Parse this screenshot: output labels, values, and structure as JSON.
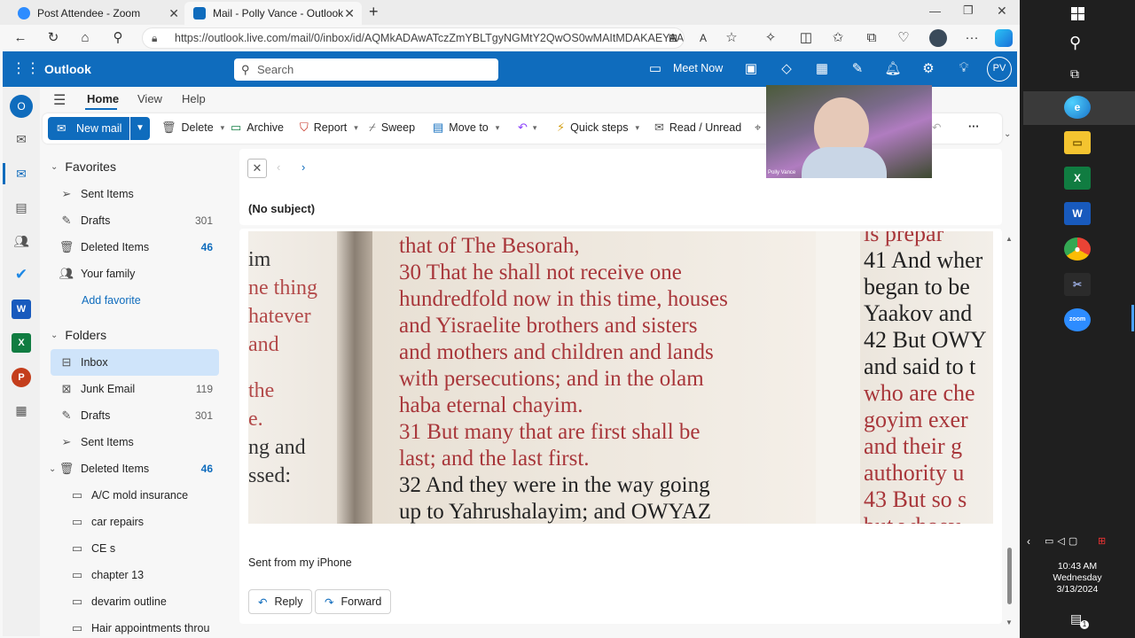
{
  "browser": {
    "tabs": [
      {
        "title": "Post Attendee - Zoom",
        "favicon": "zoom-icon",
        "active": false
      },
      {
        "title": "Mail - Polly Vance - Outlook",
        "favicon": "outlook-icon",
        "active": true
      }
    ],
    "url": "https://outlook.live.com/mail/0/inbox/id/AQMkADAwATczZmYBLTgyNGMtY2QwOS0wMAItMDAKAEYAA...",
    "new_tab": "+"
  },
  "outlook": {
    "app_name": "Outlook",
    "search_placeholder": "Search",
    "meet_now": "Meet Now",
    "avatar_initials": "PV",
    "accent_color": "#0f6cbd",
    "menu_tabs": [
      "Home",
      "View",
      "Help"
    ],
    "active_menu_tab": "Home",
    "ribbon": {
      "new_mail": "New mail",
      "delete": "Delete",
      "archive": "Archive",
      "report": "Report",
      "sweep": "Sweep",
      "move_to": "Move to",
      "quick_steps": "Quick steps",
      "read_unread": "Read / Unread",
      "more": "···"
    }
  },
  "folders": {
    "favorites_title": "Favorites",
    "favorites": [
      {
        "name": "Sent Items",
        "count": "",
        "icon": "send-icon"
      },
      {
        "name": "Drafts",
        "count": "301",
        "icon": "pencil-icon"
      },
      {
        "name": "Deleted Items",
        "count": "46",
        "icon": "trash-icon",
        "bold": true
      },
      {
        "name": "Your family",
        "count": "",
        "icon": "people-icon"
      }
    ],
    "add_favorite": "Add favorite",
    "folders_title": "Folders",
    "items": [
      {
        "name": "Inbox",
        "count": "",
        "icon": "inbox-icon",
        "selected": true
      },
      {
        "name": "Junk Email",
        "count": "119",
        "icon": "junk-icon"
      },
      {
        "name": "Drafts",
        "count": "301",
        "icon": "pencil-icon"
      },
      {
        "name": "Sent Items",
        "count": "",
        "icon": "send-icon"
      },
      {
        "name": "Deleted Items",
        "count": "46",
        "icon": "trash-icon",
        "bold": true
      }
    ],
    "subfolders": [
      "A/C mold insurance",
      "car repairs",
      "CE s",
      "chapter 13",
      "devarim outline",
      "Hair appointments throu"
    ]
  },
  "message": {
    "subject": "(No subject)",
    "signature": "Sent from my iPhone",
    "reply": "Reply",
    "forward": "Forward",
    "image_text": {
      "left": [
        "im",
        "ne thing",
        "hatever",
        "and",
        "the",
        "e.",
        "ng and",
        "ssed:"
      ],
      "center": [
        "that of The Besorah,",
        "30 That he shall not receive one",
        "hundredfold now in this time, houses",
        "and Yisraelite brothers and sisters",
        "and mothers and children and lands",
        "with persecutions; and in the olam",
        "haba eternal chayim.",
        "31 But many that are first shall be",
        "last; and the last first.",
        "32 And they were in the way going",
        "up to Yahrushalayim; and OWYAZ"
      ],
      "right": [
        "is prepar",
        "41 And wher",
        "began to be",
        "Yaakov and",
        "42 But OWY",
        "and said to t",
        "who are che",
        "goyim exer",
        "and their g",
        "authority u",
        "43 But so s",
        "but whoev"
      ]
    }
  },
  "video_overlay": {
    "name_label": "Polly Vance"
  },
  "taskbar": {
    "time": "10:43 AM",
    "day": "Wednesday",
    "date": "3/13/2024",
    "notifications_count": "1"
  }
}
